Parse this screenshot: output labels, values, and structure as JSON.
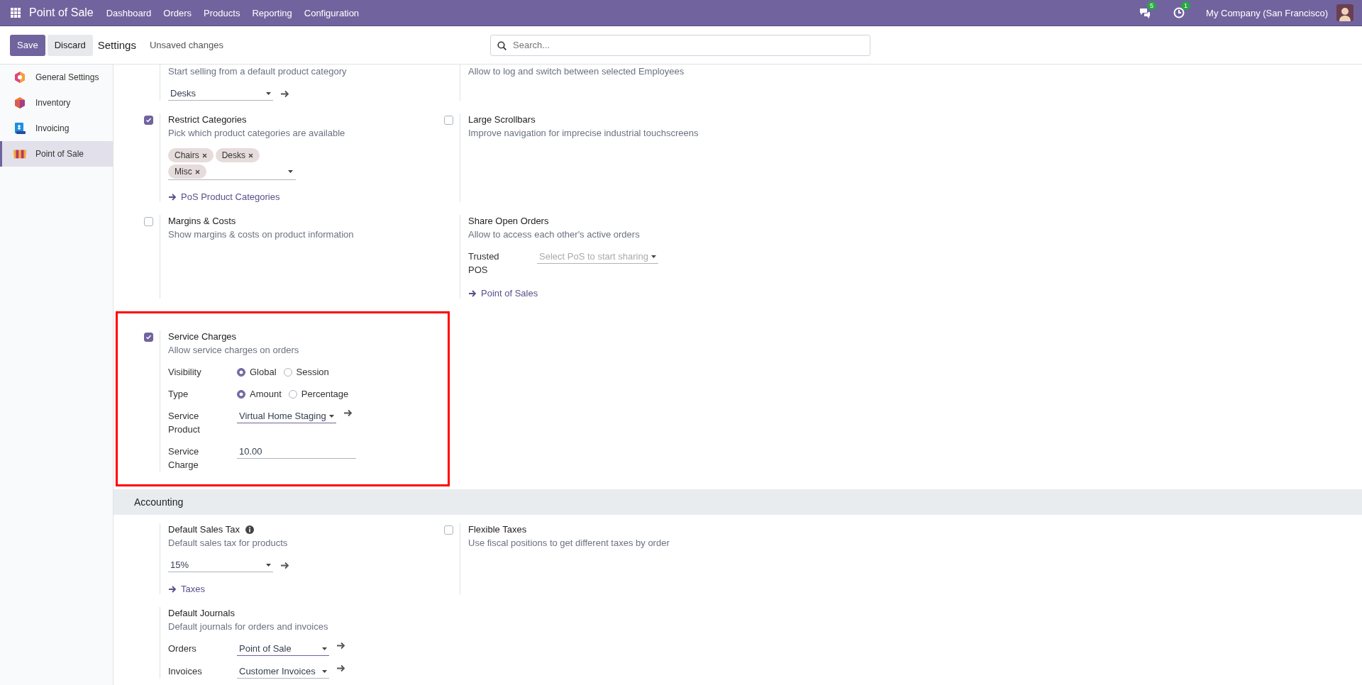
{
  "navbar": {
    "app_name": "Point of Sale",
    "menu": [
      "Dashboard",
      "Orders",
      "Products",
      "Reporting",
      "Configuration"
    ],
    "messages_count": "5",
    "activities_count": "1",
    "company": "My Company (San Francisco)"
  },
  "control_panel": {
    "save": "Save",
    "discard": "Discard",
    "breadcrumb": "Settings",
    "status": "Unsaved changes",
    "search": {
      "placeholder": "Search..."
    }
  },
  "sidebar": {
    "items": [
      {
        "label": "General Settings",
        "selected": false
      },
      {
        "label": "Inventory",
        "selected": false
      },
      {
        "label": "Invoicing",
        "selected": false
      },
      {
        "label": "Point of Sale",
        "selected": true
      }
    ]
  },
  "sections": [
    {
      "rows": [
        [
          {
            "description": "Start selling from a default product category",
            "fields": [
              {
                "kind": "select",
                "value": "Desks",
                "open_button": true,
                "highlighted": false
              }
            ]
          },
          {
            "description": "Allow to log and switch between selected Employees"
          }
        ],
        [
          {
            "checkbox": {
              "checked": true
            },
            "title": "Restrict Categories",
            "description": "Pick which product categories are available",
            "fields": [
              {
                "kind": "tags",
                "tags": [
                  "Chairs",
                  "Desks",
                  "Misc"
                ]
              }
            ],
            "link": "PoS Product Categories"
          },
          {
            "checkbox": {
              "checked": false
            },
            "title": "Large Scrollbars",
            "description": "Improve navigation for imprecise industrial touchscreens"
          }
        ],
        [
          {
            "checkbox": {
              "checked": false
            },
            "title": "Margins & Costs",
            "description": "Show margins & costs on product information"
          },
          {
            "title": "Share Open Orders",
            "description": "Allow to access each other's active orders",
            "fields": [
              {
                "kind": "select",
                "label": "Trusted POS",
                "placeholder": "Select PoS to start sharing",
                "highlighted": false
              }
            ],
            "link": "Point of Sales"
          }
        ],
        [
          {
            "highlighted": true,
            "checkbox": {
              "checked": true
            },
            "title": "Service Charges",
            "description": "Allow service charges on orders",
            "fields": [
              {
                "kind": "radio",
                "label": "Visibility",
                "options": [
                  {
                    "label": "Global",
                    "selected": true
                  },
                  {
                    "label": "Session",
                    "selected": false
                  }
                ]
              },
              {
                "kind": "radio",
                "label": "Type",
                "options": [
                  {
                    "label": "Amount",
                    "selected": true
                  },
                  {
                    "label": "Percentage",
                    "selected": false
                  }
                ]
              },
              {
                "kind": "select",
                "label": "Service Product",
                "value": "Virtual Home Staging",
                "open_button": true,
                "highlighted": true
              },
              {
                "kind": "input",
                "label": "Service Charge",
                "value": "10.00"
              }
            ]
          }
        ]
      ]
    },
    {
      "title": "Accounting",
      "rows": [
        [
          {
            "title": "Default Sales Tax",
            "help_icon": true,
            "description": "Default sales tax for products",
            "fields": [
              {
                "kind": "select",
                "value": "15%",
                "open_button": true,
                "highlighted": false
              }
            ],
            "link": "Taxes"
          },
          {
            "checkbox": {
              "checked": false
            },
            "title": "Flexible Taxes",
            "description": "Use fiscal positions to get different taxes by order"
          }
        ],
        [
          {
            "title": "Default Journals",
            "description": "Default journals for orders and invoices",
            "fields": [
              {
                "kind": "select",
                "label": "Orders",
                "value": "Point of Sale",
                "open_button": true,
                "highlighted": true
              },
              {
                "kind": "select",
                "label": "Invoices",
                "value": "Customer Invoices",
                "open_button": true,
                "highlighted": false
              }
            ]
          }
        ]
      ]
    }
  ]
}
